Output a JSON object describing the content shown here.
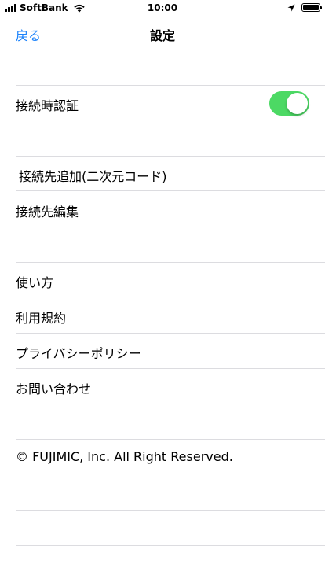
{
  "status_bar": {
    "carrier": "SoftBank",
    "time": "10:00"
  },
  "nav": {
    "back_label": "戻る",
    "title": "設定"
  },
  "sections": {
    "auth": {
      "label": "接続時認証",
      "toggle_on": true,
      "toggle_color": "#4cd964"
    },
    "connection": {
      "add_qr": "接続先追加(二次元コード)",
      "edit": "接続先編集"
    },
    "info": {
      "how_to_use": "使い方",
      "terms": "利用規約",
      "privacy": "プライバシーポリシー",
      "contact": "お問い合わせ"
    },
    "footer": {
      "copyright": "© FUJIMIC, Inc. All Right Reserved."
    }
  },
  "colors": {
    "accent": "#1a82fb",
    "separator": "#dcdce0"
  }
}
